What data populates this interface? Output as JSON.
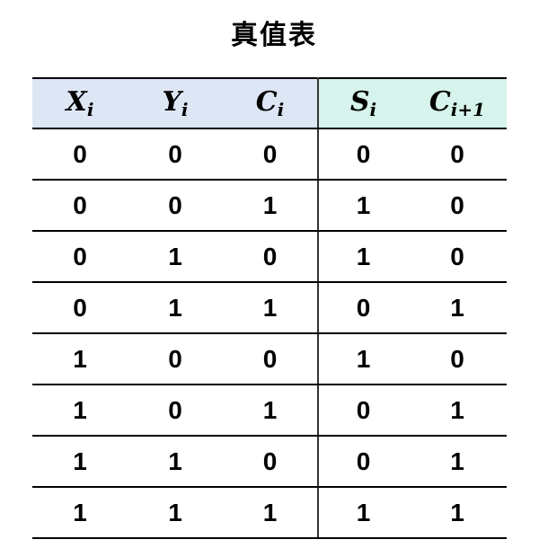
{
  "title": "真值表",
  "headers": {
    "inputs": [
      {
        "base": "X",
        "sub": "i"
      },
      {
        "base": "Y",
        "sub": "i"
      },
      {
        "base": "C",
        "sub": "i"
      }
    ],
    "outputs": [
      {
        "base": "S",
        "sub": "i"
      },
      {
        "base": "C",
        "sub": "i+1"
      }
    ]
  },
  "rows": [
    [
      "0",
      "0",
      "0",
      "0",
      "0"
    ],
    [
      "0",
      "0",
      "1",
      "1",
      "0"
    ],
    [
      "0",
      "1",
      "0",
      "1",
      "0"
    ],
    [
      "0",
      "1",
      "1",
      "0",
      "1"
    ],
    [
      "1",
      "0",
      "0",
      "1",
      "0"
    ],
    [
      "1",
      "0",
      "1",
      "0",
      "1"
    ],
    [
      "1",
      "1",
      "0",
      "0",
      "1"
    ],
    [
      "1",
      "1",
      "1",
      "1",
      "1"
    ]
  ],
  "colors": {
    "input_header_bg": "#dce6f5",
    "output_header_bg": "#d6f3ec"
  }
}
